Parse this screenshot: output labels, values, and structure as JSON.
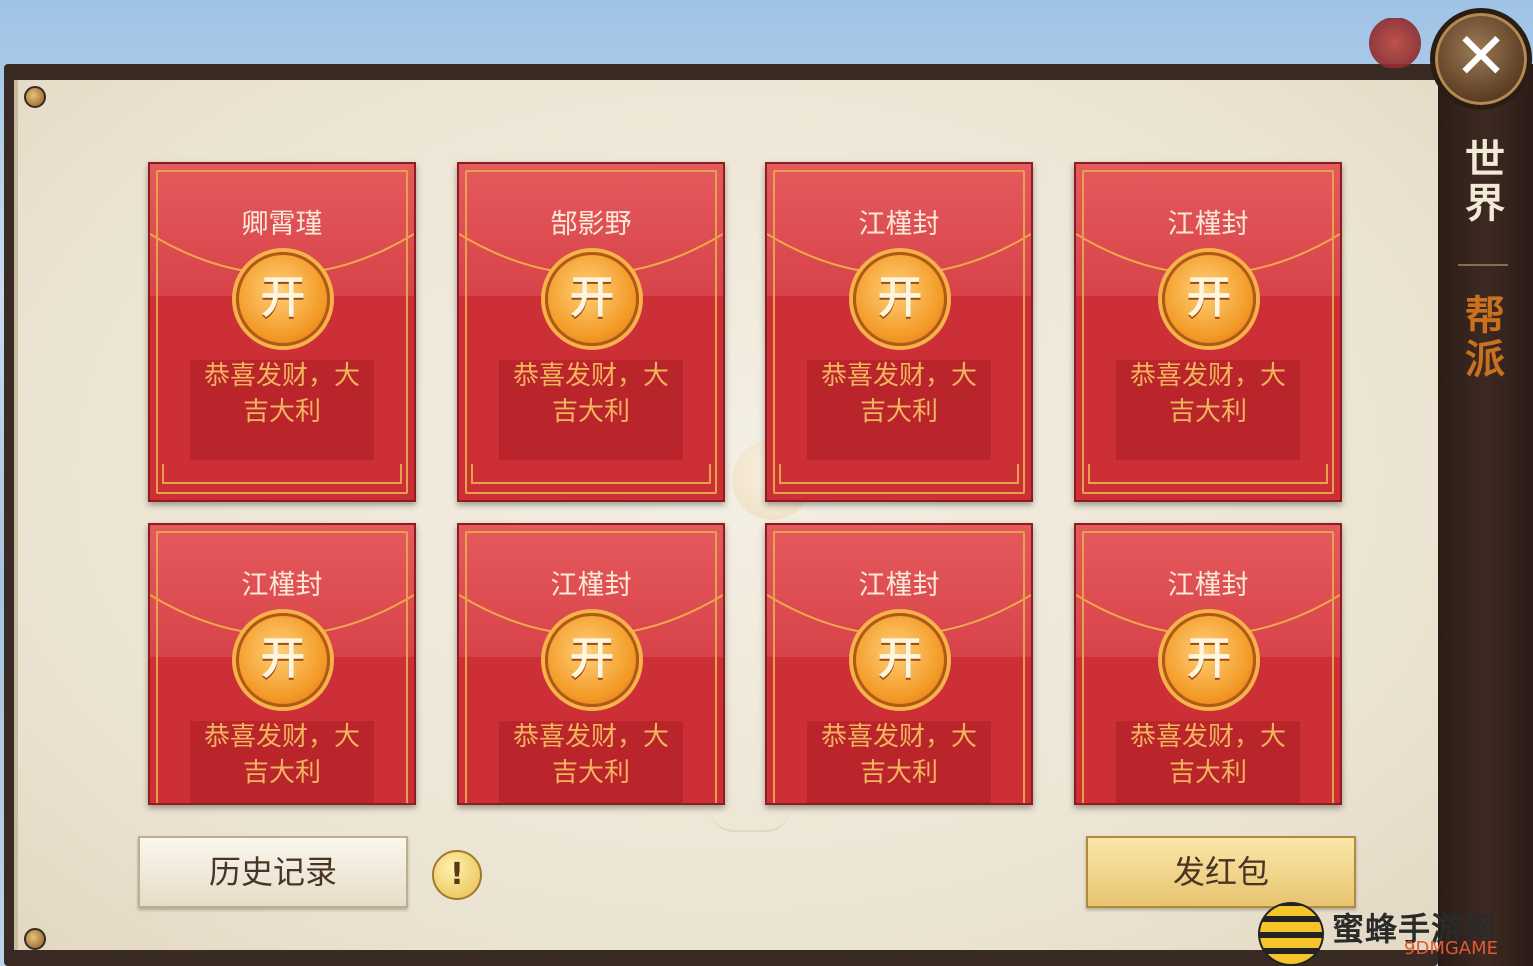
{
  "window": {
    "close_icon": "close-x-icon"
  },
  "side_tabs": [
    {
      "label": "世界",
      "active": false,
      "color": "#f2ead6"
    },
    {
      "label": "帮派",
      "active": true,
      "color": "#c9711f"
    }
  ],
  "red_envelopes": [
    {
      "sender": "卿霄瑾",
      "open_label": "开",
      "message": [
        "恭喜发财，大",
        "吉大利"
      ]
    },
    {
      "sender": "郜影野",
      "open_label": "开",
      "message": [
        "恭喜发财，大",
        "吉大利"
      ]
    },
    {
      "sender": "江槿封",
      "open_label": "开",
      "message": [
        "恭喜发财，大",
        "吉大利"
      ]
    },
    {
      "sender": "江槿封",
      "open_label": "开",
      "message": [
        "恭喜发财，大",
        "吉大利"
      ]
    },
    {
      "sender": "江槿封",
      "open_label": "开",
      "message": [
        "恭喜发财，大",
        "吉大利"
      ]
    },
    {
      "sender": "江槿封",
      "open_label": "开",
      "message": [
        "恭喜发财，大",
        "吉大利"
      ]
    },
    {
      "sender": "江槿封",
      "open_label": "开",
      "message": [
        "恭喜发财，大",
        "吉大利"
      ]
    },
    {
      "sender": "江槿封",
      "open_label": "开",
      "message": [
        "恭喜发财，大",
        "吉大利"
      ]
    }
  ],
  "footer": {
    "history_label": "历史记录",
    "info_label": "!",
    "send_label": "发红包"
  },
  "watermark": {
    "text": "蜜蜂手游网",
    "sub": "9DMGAME"
  },
  "colors": {
    "envelope_red": "#cc2f35",
    "coin_gold": "#f39a26",
    "paper": "#f4efe4",
    "frame": "#3a2a24"
  }
}
